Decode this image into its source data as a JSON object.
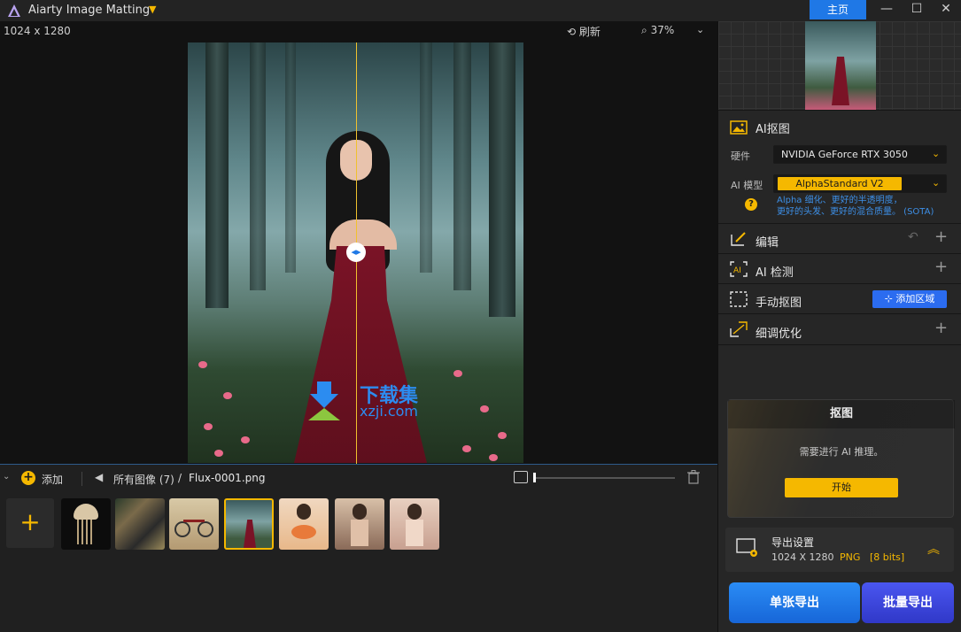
{
  "window": {
    "title": "Aiarty Image Matting",
    "home_label": "主页",
    "minimize_glyph": "—",
    "maximize_glyph": "☐",
    "close_glyph": "✕"
  },
  "canvas": {
    "dimensions": "1024 x 1280",
    "refresh_label": "刷新",
    "zoom_label": "37%"
  },
  "watermark": {
    "cn": "下载集",
    "en": "xzji.com"
  },
  "filmstrip": {
    "add_label": "添加",
    "all_images_label": "所有图像 (7)",
    "separator": "/",
    "current_file": "Flux-0001.png",
    "thumbnails": [
      "jellyfish",
      "abstract",
      "bicycle",
      "woman-forest",
      "woman-flowers-1",
      "woman-flowers-2",
      "woman-flowers-3"
    ],
    "active_index": 3
  },
  "panel": {
    "ai_matting_label": "AI抠图",
    "hardware_label": "硬件",
    "hardware_value": "NVIDIA GeForce RTX 3050",
    "model_label": "AI 模型",
    "model_value": "AlphaStandard  V2",
    "model_desc_line1": "Alpha 细化、更好的半透明度，",
    "model_desc_line2": "更好的头发、更好的混合质量。 (SOTA)",
    "help_glyph": "?",
    "edit_label": "编辑",
    "ai_detect_label": "AI 检测",
    "manual_label": "手动抠图",
    "add_region_label": "添加区域",
    "refine_label": "细调优化",
    "matte_title": "抠图",
    "matte_message": "需要进行 AI 推理。",
    "start_label": "开始",
    "export_title": "导出设置",
    "export_size": "1024 X 1280",
    "export_format": "PNG",
    "export_bits": "[8 bits]",
    "single_export_label": "单张导出",
    "batch_export_label": "批量导出"
  },
  "colors": {
    "accent": "#f5b800",
    "primary_blue": "#1f78e6",
    "batch_blue": "#3a44dc",
    "background": "#1b1b1b"
  }
}
